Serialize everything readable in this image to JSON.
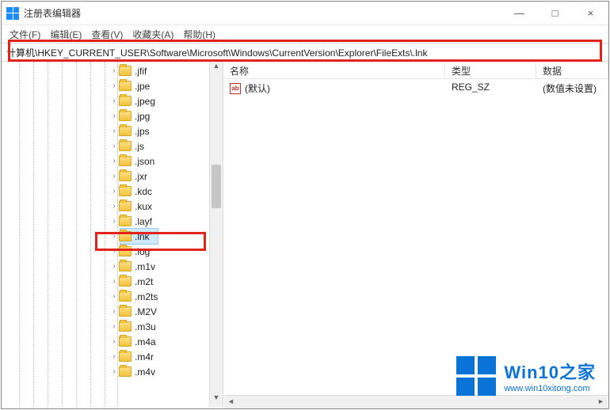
{
  "window": {
    "title": "注册表编辑器",
    "controls": {
      "min": "—",
      "max": "□",
      "close": "×"
    }
  },
  "menu": {
    "file": "文件(F)",
    "edit": "编辑(E)",
    "view": "查看(V)",
    "favorites": "收藏夹(A)",
    "help": "帮助(H)"
  },
  "address": "计算机\\HKEY_CURRENT_USER\\Software\\Microsoft\\Windows\\CurrentVersion\\Explorer\\FileExts\\.lnk",
  "tree": {
    "items": [
      {
        "label": ".jfif",
        "expandable": true
      },
      {
        "label": ".jpe",
        "expandable": true
      },
      {
        "label": ".jpeg",
        "expandable": true
      },
      {
        "label": ".jpg",
        "expandable": true
      },
      {
        "label": ".jps",
        "expandable": true
      },
      {
        "label": ".js",
        "expandable": true
      },
      {
        "label": ".json",
        "expandable": true
      },
      {
        "label": ".jxr",
        "expandable": true
      },
      {
        "label": ".kdc",
        "expandable": true
      },
      {
        "label": ".kux",
        "expandable": true
      },
      {
        "label": ".layf",
        "expandable": true
      },
      {
        "label": ".lnk",
        "expandable": true,
        "selected": true
      },
      {
        "label": ".log",
        "expandable": true
      },
      {
        "label": ".m1v",
        "expandable": true
      },
      {
        "label": ".m2t",
        "expandable": true
      },
      {
        "label": ".m2ts",
        "expandable": true
      },
      {
        "label": ".M2V",
        "expandable": true
      },
      {
        "label": ".m3u",
        "expandable": true
      },
      {
        "label": ".m4a",
        "expandable": true
      },
      {
        "label": ".m4r",
        "expandable": true
      },
      {
        "label": ".m4v",
        "expandable": true
      }
    ]
  },
  "list": {
    "columns": {
      "name": "名称",
      "type": "类型",
      "data": "数据"
    },
    "rows": [
      {
        "icon": "ab",
        "name": "(默认)",
        "type": "REG_SZ",
        "data": "(数值未设置)"
      }
    ]
  },
  "watermark": {
    "title": "Win10之家",
    "sub": "www.win10xitong.com"
  }
}
